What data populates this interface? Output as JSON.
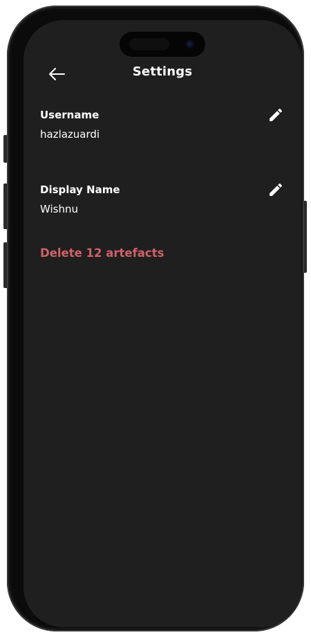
{
  "header": {
    "title": "Settings"
  },
  "settings": {
    "username": {
      "label": "Username",
      "value": "hazlazuardi"
    },
    "display_name": {
      "label": "Display Name",
      "value": "Wishnu"
    },
    "delete_action": "Delete 12 artefacts"
  },
  "colors": {
    "screen_background": "#1f1f1f",
    "text_primary": "#ffffff",
    "danger": "#cf6268"
  },
  "icons": {
    "back": "arrow-left-icon",
    "edit": "pencil-icon"
  }
}
